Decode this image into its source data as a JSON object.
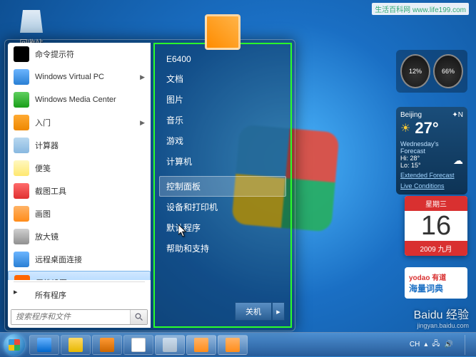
{
  "desktop": {
    "recycle_bin": "回收站"
  },
  "start_menu": {
    "programs": [
      {
        "label": "命令提示符",
        "icon": "c-cmd",
        "arrow": false
      },
      {
        "label": "Windows Virtual PC",
        "icon": "c-vpc",
        "arrow": true
      },
      {
        "label": "Windows Media Center",
        "icon": "c-wmc",
        "arrow": false
      },
      {
        "label": "入门",
        "icon": "c-start",
        "arrow": true
      },
      {
        "label": "计算器",
        "icon": "c-calc",
        "arrow": false
      },
      {
        "label": "便笺",
        "icon": "c-note",
        "arrow": false
      },
      {
        "label": "截图工具",
        "icon": "c-snip",
        "arrow": false
      },
      {
        "label": "画图",
        "icon": "c-paint",
        "arrow": false
      },
      {
        "label": "放大镜",
        "icon": "c-mag",
        "arrow": false
      },
      {
        "label": "远程桌面连接",
        "icon": "c-rdp",
        "arrow": false
      },
      {
        "label": "属性设置",
        "icon": "c-sogou",
        "arrow": false,
        "selected": true
      }
    ],
    "all_programs": "所有程序",
    "search_placeholder": "搜索程序和文件",
    "right_items_1": [
      "E6400",
      "文档",
      "图片",
      "音乐",
      "游戏",
      "计算机"
    ],
    "right_items_2": [
      "控制面板",
      "设备和打印机",
      "默认程序",
      "帮助和支持"
    ],
    "hovered_right": "控制面板",
    "shutdown_label": "关机"
  },
  "gadgets": {
    "cpu": {
      "cpu_pct": "12%",
      "ram_pct": "66%"
    },
    "weather": {
      "city": "Beijing",
      "temp": "27°",
      "forecast_title": "Wednesday's Forecast",
      "hi": "Hi: 28°",
      "lo": "Lo: 15°",
      "extended": "Extended Forecast",
      "live": "Live Conditions"
    },
    "calendar": {
      "weekday": "星期三",
      "day": "16",
      "month_year": "2009 九月"
    },
    "youdao": {
      "brand": "yodao 有道",
      "tagline": "海量词典"
    }
  },
  "tray": {
    "time": "",
    "lang": "CH"
  },
  "watermarks": {
    "baidu": "Baidu 经验",
    "baidu_sub": "jingyan.baidu.com",
    "top": "生活百科网 www.life199.com"
  }
}
